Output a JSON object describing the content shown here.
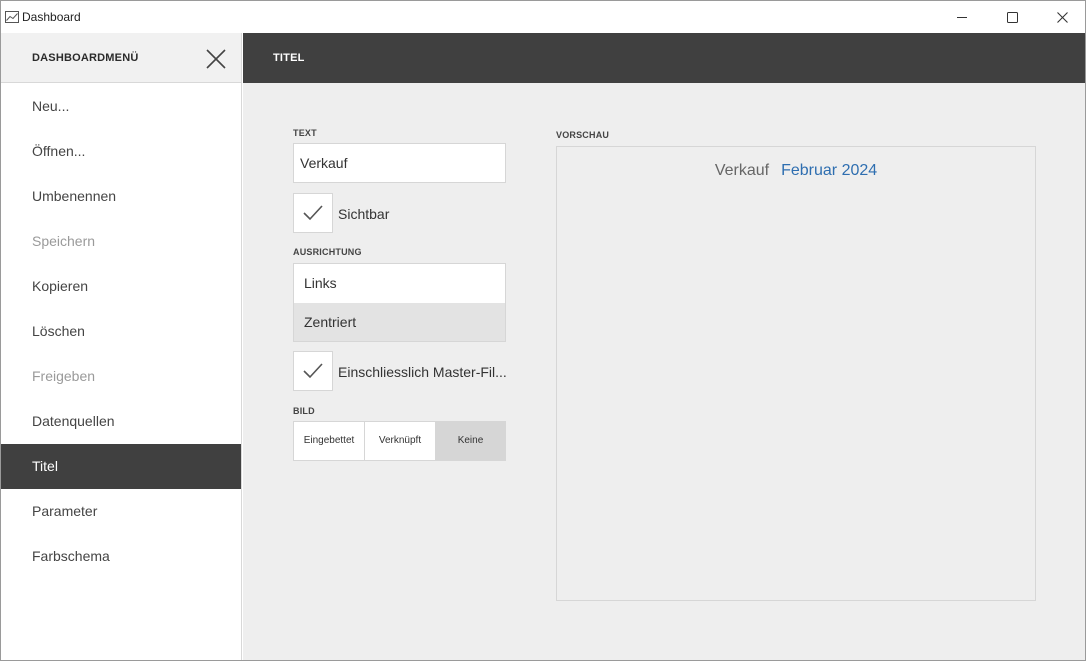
{
  "window": {
    "title": "Dashboard",
    "icons": {
      "app": "chart-line-icon",
      "minimize": "minimize-icon",
      "maximize": "maximize-icon",
      "close": "close-icon"
    }
  },
  "sidebar": {
    "title": "DASHBOARDMENÜ",
    "close_icon": "close-icon",
    "items": [
      {
        "label": "Neu...",
        "state": "normal"
      },
      {
        "label": "Öffnen...",
        "state": "normal"
      },
      {
        "label": "Umbenennen",
        "state": "normal"
      },
      {
        "label": "Speichern",
        "state": "disabled"
      },
      {
        "label": "Kopieren",
        "state": "normal"
      },
      {
        "label": "Löschen",
        "state": "normal"
      },
      {
        "label": "Freigeben",
        "state": "disabled"
      },
      {
        "label": "Datenquellen",
        "state": "normal"
      },
      {
        "label": "Titel",
        "state": "selected"
      },
      {
        "label": "Parameter",
        "state": "normal"
      },
      {
        "label": "Farbschema",
        "state": "normal"
      }
    ]
  },
  "main": {
    "title": "TITEL",
    "text_caption": "TEXT",
    "text_value": "Verkauf",
    "visible_label": "Sichtbar",
    "visible_checked": true,
    "alignment_caption": "AUSRICHTUNG",
    "alignment_options": [
      "Links",
      "Zentriert"
    ],
    "alignment_selected": "Zentriert",
    "master_filter_label": "Einschliesslich Master-Fil...",
    "master_filter_checked": true,
    "image_caption": "BILD",
    "image_options": [
      "Eingebettet",
      "Verknüpft",
      "Keine"
    ],
    "image_selected": "Keine",
    "preview_caption": "VORSCHAU",
    "preview_title_text": "Verkauf",
    "preview_title_value": "Februar 2024"
  },
  "colors": {
    "header_dark": "#404040",
    "accent_blue": "#2e6eb0",
    "panel_bg": "#eeeeee"
  }
}
